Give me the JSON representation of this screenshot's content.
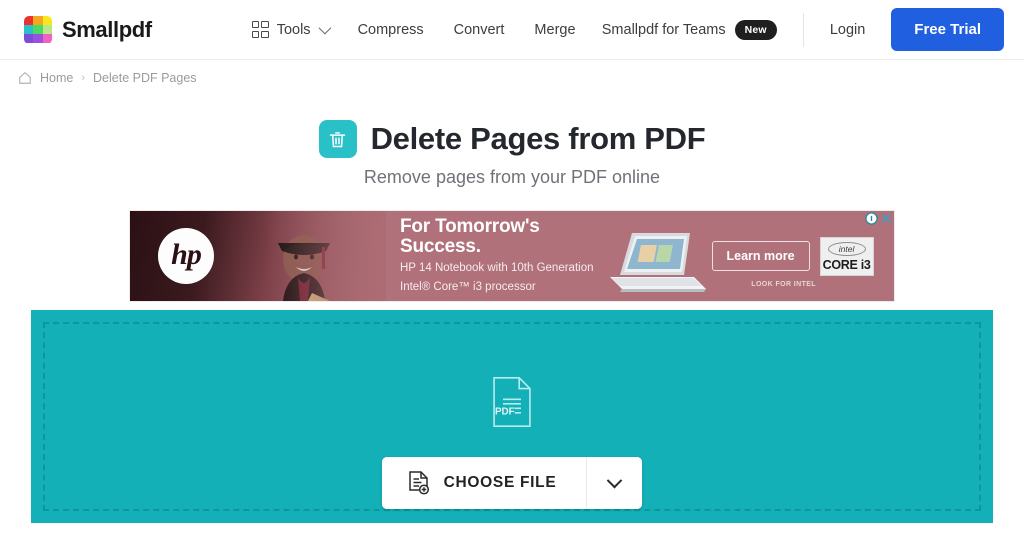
{
  "brand": {
    "name": "Smallpdf",
    "logo_colors": [
      "#e8342c",
      "#f5a623",
      "#f8e71c",
      "#29c0c7",
      "#4cd964",
      "#b8e986",
      "#7b4dd8",
      "#9b51e0",
      "#f062c0"
    ],
    "logo_icon": "smallpdf-logo-grid-icon"
  },
  "nav": {
    "tools": {
      "label": "Tools",
      "icon": "grid-icon",
      "caret": "chevron-down-icon"
    },
    "items": [
      {
        "label": "Compress"
      },
      {
        "label": "Convert"
      },
      {
        "label": "Merge"
      }
    ],
    "teams": {
      "label": "Smallpdf for Teams",
      "badge": "New"
    },
    "login": {
      "label": "Login"
    },
    "trial": {
      "label": "Free Trial",
      "color": "#1f5fe0"
    }
  },
  "breadcrumb": {
    "home": {
      "label": "Home",
      "icon": "home-icon"
    },
    "separator": "›",
    "current": "Delete PDF Pages"
  },
  "hero": {
    "icon": "trash-can-icon",
    "icon_color": "#29c0c7",
    "title": "Delete Pages from PDF",
    "subtitle": "Remove pages from your PDF online"
  },
  "ad": {
    "brand_logo": "hp-logo-icon",
    "brand_text": "hp",
    "headline_line1": "For Tomorrow's",
    "headline_line2": "Success.",
    "body_line1": "HP 14 Notebook with 10th Generation",
    "body_line2": "Intel® Core™ i3 processor",
    "cta": "Learn more",
    "look_for": "LOOK FOR INTEL",
    "chip_brand": "intel",
    "chip_model": "CORE i3",
    "laptop_icon": "laptop-image",
    "info_icon": "adchoices-info-icon",
    "close_icon": "close-icon",
    "background_color": "#b0717a"
  },
  "dropzone": {
    "background_color": "#13b0b8",
    "file_icon": "pdf-file-icon",
    "file_icon_label": "PDF",
    "choose_file": {
      "label": "CHOOSE FILE",
      "icon": "add-document-icon",
      "caret": "chevron-down-icon"
    }
  }
}
